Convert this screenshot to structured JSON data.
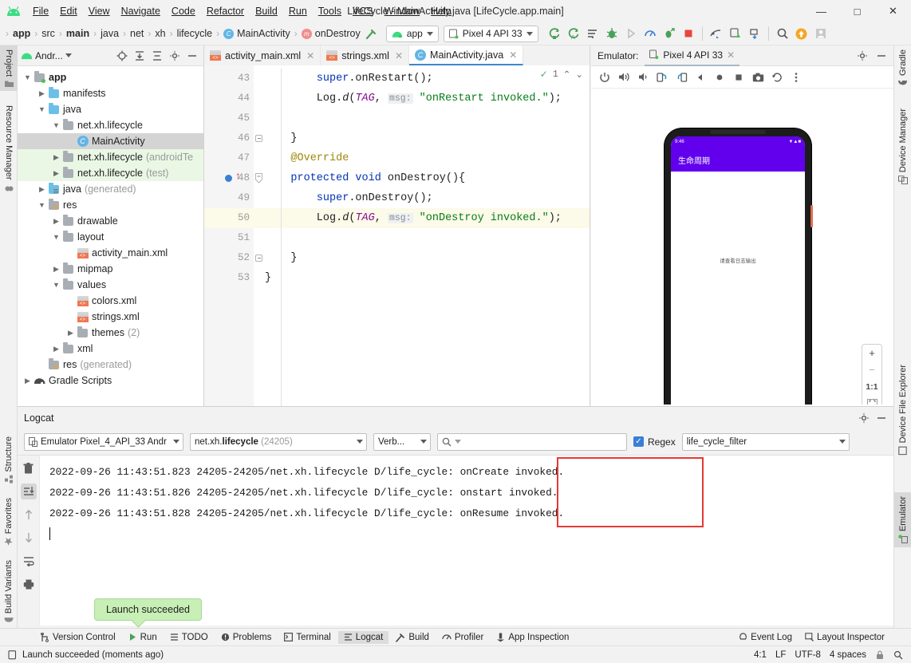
{
  "window": {
    "title": "LifeCycle - MainActivity.java [LifeCycle.app.main]",
    "minimize": "—",
    "maximize": "□",
    "close": "✕"
  },
  "menu": [
    "File",
    "Edit",
    "View",
    "Navigate",
    "Code",
    "Refactor",
    "Build",
    "Run",
    "Tools",
    "VCS",
    "Window",
    "Help"
  ],
  "breadcrumb": [
    {
      "label": "app",
      "bold": true,
      "icon": ""
    },
    {
      "label": "src",
      "bold": false,
      "icon": ""
    },
    {
      "label": "main",
      "bold": true,
      "icon": ""
    },
    {
      "label": "java",
      "bold": false,
      "icon": ""
    },
    {
      "label": "net",
      "bold": false,
      "icon": ""
    },
    {
      "label": "xh",
      "bold": false,
      "icon": ""
    },
    {
      "label": "lifecycle",
      "bold": false,
      "icon": ""
    },
    {
      "label": "MainActivity",
      "bold": false,
      "icon": "class"
    },
    {
      "label": "onDestroy",
      "bold": false,
      "icon": "method"
    }
  ],
  "toolbar": {
    "module_selector": "app",
    "device_selector": "Pixel 4 API 33",
    "icons": [
      "sync-gradle-icon",
      "avd-manager-icon",
      "code-format-icon",
      "debug-icon",
      "run-disabled-icon",
      "profiler-icon",
      "attach-debugger-icon",
      "stop-icon",
      "sdk-manager-icon",
      "device-manager-icon",
      "layout-inspector-icon",
      "search-everywhere-icon",
      "update-icon",
      "account-icon"
    ]
  },
  "left_strip": [
    {
      "label": "Project",
      "active": true,
      "icon": "folder-icon"
    },
    {
      "label": "Resource Manager",
      "active": false,
      "icon": "resource-icon"
    },
    {
      "label": "Structure",
      "active": false,
      "icon": "structure-icon"
    },
    {
      "label": "Favorites",
      "active": false,
      "icon": "star-icon"
    },
    {
      "label": "Build Variants",
      "active": false,
      "icon": "variants-icon"
    }
  ],
  "right_strip": [
    {
      "label": "Gradle",
      "active": false,
      "icon": "gradle-elephant-icon"
    },
    {
      "label": "Device Manager",
      "active": false,
      "icon": "device-icon"
    },
    {
      "label": "Device File Explorer",
      "active": false,
      "icon": "device-file-icon"
    },
    {
      "label": "Emulator",
      "active": true,
      "icon": "emulator-icon"
    }
  ],
  "project_panel": {
    "title": "Andr...",
    "header_icons": [
      "locate-icon",
      "expand-all-icon",
      "collapse-all-icon",
      "settings-gear-icon",
      "hide-icon"
    ],
    "tree": [
      {
        "label": "app",
        "indent": 0,
        "arrow": "down",
        "icon": "module-folder",
        "bold": true,
        "muted": "",
        "selected": false,
        "green": false
      },
      {
        "label": "manifests",
        "indent": 1,
        "arrow": "right",
        "icon": "folder-blue",
        "bold": false,
        "muted": "",
        "selected": false,
        "green": false
      },
      {
        "label": "java",
        "indent": 1,
        "arrow": "down",
        "icon": "folder-blue",
        "bold": false,
        "muted": "",
        "selected": false,
        "green": false
      },
      {
        "label": "net.xh.lifecycle",
        "indent": 2,
        "arrow": "down",
        "icon": "folder-pkg",
        "bold": false,
        "muted": "",
        "selected": false,
        "green": false
      },
      {
        "label": "MainActivity",
        "indent": 3,
        "arrow": "none",
        "icon": "class",
        "bold": false,
        "muted": "",
        "selected": true,
        "green": false
      },
      {
        "label": "net.xh.lifecycle",
        "indent": 2,
        "arrow": "right",
        "icon": "folder-pkg",
        "bold": false,
        "muted": "(androidTe",
        "selected": false,
        "green": true
      },
      {
        "label": "net.xh.lifecycle",
        "indent": 2,
        "arrow": "right",
        "icon": "folder-pkg",
        "bold": false,
        "muted": "(test)",
        "selected": false,
        "green": true
      },
      {
        "label": "java",
        "indent": 1,
        "arrow": "right",
        "icon": "folder-gen",
        "bold": false,
        "muted": "(generated)",
        "selected": false,
        "green": false
      },
      {
        "label": "res",
        "indent": 1,
        "arrow": "down",
        "icon": "folder-res",
        "bold": false,
        "muted": "",
        "selected": false,
        "green": false
      },
      {
        "label": "drawable",
        "indent": 2,
        "arrow": "right",
        "icon": "folder-pkg",
        "bold": false,
        "muted": "",
        "selected": false,
        "green": false
      },
      {
        "label": "layout",
        "indent": 2,
        "arrow": "down",
        "icon": "folder-pkg",
        "bold": false,
        "muted": "",
        "selected": false,
        "green": false
      },
      {
        "label": "activity_main.xml",
        "indent": 3,
        "arrow": "none",
        "icon": "xml",
        "bold": false,
        "muted": "",
        "selected": false,
        "green": false
      },
      {
        "label": "mipmap",
        "indent": 2,
        "arrow": "right",
        "icon": "folder-pkg",
        "bold": false,
        "muted": "",
        "selected": false,
        "green": false
      },
      {
        "label": "values",
        "indent": 2,
        "arrow": "down",
        "icon": "folder-pkg",
        "bold": false,
        "muted": "",
        "selected": false,
        "green": false
      },
      {
        "label": "colors.xml",
        "indent": 3,
        "arrow": "none",
        "icon": "xml",
        "bold": false,
        "muted": "",
        "selected": false,
        "green": false
      },
      {
        "label": "strings.xml",
        "indent": 3,
        "arrow": "none",
        "icon": "xml",
        "bold": false,
        "muted": "",
        "selected": false,
        "green": false
      },
      {
        "label": "themes",
        "indent": 3,
        "arrow": "right",
        "icon": "folder-pkg",
        "bold": false,
        "muted": "(2)",
        "selected": false,
        "green": false
      },
      {
        "label": "xml",
        "indent": 2,
        "arrow": "right",
        "icon": "folder-pkg",
        "bold": false,
        "muted": "",
        "selected": false,
        "green": false
      },
      {
        "label": "res",
        "indent": 1,
        "arrow": "none",
        "icon": "folder-res",
        "bold": false,
        "muted": "(generated)",
        "selected": false,
        "green": false
      },
      {
        "label": "Gradle Scripts",
        "indent": 0,
        "arrow": "right",
        "icon": "gradle",
        "bold": false,
        "muted": "",
        "selected": false,
        "green": false
      }
    ]
  },
  "editor": {
    "tabs": [
      {
        "label": "activity_main.xml",
        "icon": "xml",
        "active": false
      },
      {
        "label": "strings.xml",
        "icon": "xml",
        "active": false
      },
      {
        "label": "MainActivity.java",
        "icon": "class",
        "active": true
      }
    ],
    "inspection_count": "1",
    "inspection_up": "⌃",
    "inspection_down": "⌄",
    "lines": [
      {
        "num": "43",
        "html": "        <span class='kw'>super</span>.onRestart();",
        "highlight": false,
        "fold": "none",
        "breakpoint": false
      },
      {
        "num": "44",
        "html": "        Log.<span class='mth'>d</span>(<span class='fld'>TAG</span>, <span class='hint'>msg:</span> <span class='str'>\"onRestart invoked.\"</span>);",
        "highlight": false,
        "fold": "none",
        "breakpoint": false
      },
      {
        "num": "45",
        "html": "",
        "highlight": false,
        "fold": "none",
        "breakpoint": false
      },
      {
        "num": "46",
        "html": "    }",
        "highlight": false,
        "fold": "end",
        "breakpoint": false
      },
      {
        "num": "47",
        "html": "    <span class='ann'>@Override</span>",
        "highlight": false,
        "fold": "none",
        "breakpoint": false
      },
      {
        "num": "48",
        "html": "    <span class='kw'>protected void</span> onDestroy(){",
        "highlight": false,
        "fold": "start",
        "breakpoint": true
      },
      {
        "num": "49",
        "html": "        <span class='kw'>super</span>.onDestroy();",
        "highlight": false,
        "fold": "none",
        "breakpoint": false
      },
      {
        "num": "50",
        "html": "        Log.<span class='mth'>d</span>(<span class='fld'>TAG</span>, <span class='hint'>msg:</span> <span class='str'>\"onDestroy invoked.\"</span>);",
        "highlight": true,
        "fold": "none",
        "breakpoint": false
      },
      {
        "num": "51",
        "html": "",
        "highlight": false,
        "fold": "none",
        "breakpoint": false
      },
      {
        "num": "52",
        "html": "    }",
        "highlight": false,
        "fold": "end",
        "breakpoint": false
      },
      {
        "num": "53",
        "html": "}",
        "highlight": false,
        "fold": "none",
        "breakpoint": false
      }
    ]
  },
  "emulator": {
    "label": "Emulator:",
    "tab": "Pixel 4 API 33",
    "tab_close": "✕",
    "settings_icon": "gear-icon",
    "hide_icon": "hide-icon",
    "toolbar_icons": [
      "power-icon",
      "volume-up-icon",
      "volume-down-icon",
      "rotate-left-icon",
      "rotate-right-icon",
      "back-icon",
      "home-icon",
      "overview-icon",
      "screenshot-icon",
      "history-icon",
      "more-icon"
    ],
    "device": {
      "status_time": "9:46",
      "app_bar_title": "生命周期",
      "screen_text": "请查看日志输出",
      "primary_color": "#6200ee"
    },
    "zoom_controls": {
      "zoom_in": "+",
      "zoom_out": "−",
      "actual_size": "1:1",
      "fit": "fit-icon"
    }
  },
  "logcat": {
    "title": "Logcat",
    "settings_icon": "gear-icon",
    "hide_icon": "hide-icon",
    "device_selector": "Emulator Pixel_4_API_33 Andr",
    "process_selector_prefix": "net.xh.",
    "process_selector_bold": "lifecycle",
    "process_selector_pid": "(24205)",
    "level_selector": "Verb...",
    "search_placeholder": "",
    "search_value": "",
    "regex_label": "Regex",
    "regex_checked": true,
    "filter_selector": "life_cycle_filter",
    "tools": [
      "clear-logcat-icon",
      "scroll-to-end-icon",
      "up-arrow-icon",
      "down-arrow-icon",
      "soft-wrap-icon",
      "print-icon"
    ],
    "entries": [
      {
        "timestamp": "2022-09-26 11:43:51.823",
        "pid": "24205-24205/net.xh.lifecycle",
        "level": "D/life_cycle:",
        "message": "onCreate invoked."
      },
      {
        "timestamp": "2022-09-26 11:43:51.826",
        "pid": "24205-24205/net.xh.lifecycle",
        "level": "D/life_cycle:",
        "message": "onstart invoked."
      },
      {
        "timestamp": "2022-09-26 11:43:51.828",
        "pid": "24205-24205/net.xh.lifecycle",
        "level": "D/life_cycle:",
        "message": "onResume invoked."
      }
    ],
    "highlight_color": "#e53935"
  },
  "tooltip": {
    "text": "Launch succeeded"
  },
  "bottom_tabs": [
    {
      "label": "Version Control",
      "icon": "branch-icon",
      "active": false
    },
    {
      "label": "Run",
      "icon": "run-icon",
      "active": false
    },
    {
      "label": "TODO",
      "icon": "todo-icon",
      "active": false
    },
    {
      "label": "Problems",
      "icon": "problems-icon",
      "active": false
    },
    {
      "label": "Terminal",
      "icon": "terminal-icon",
      "active": false
    },
    {
      "label": "Logcat",
      "icon": "logcat-icon",
      "active": true
    },
    {
      "label": "Build",
      "icon": "build-icon",
      "active": false
    },
    {
      "label": "Profiler",
      "icon": "profiler-icon",
      "active": false
    },
    {
      "label": "App Inspection",
      "icon": "inspection-icon",
      "active": false
    }
  ],
  "bottom_tabs_right": [
    {
      "label": "Event Log",
      "icon": "event-log-icon"
    },
    {
      "label": "Layout Inspector",
      "icon": "layout-inspector-icon"
    }
  ],
  "statusbar": {
    "message": "Launch succeeded (moments ago)",
    "caret": "4:1",
    "line_sep": "LF",
    "encoding": "UTF-8",
    "indent": "4 spaces"
  }
}
